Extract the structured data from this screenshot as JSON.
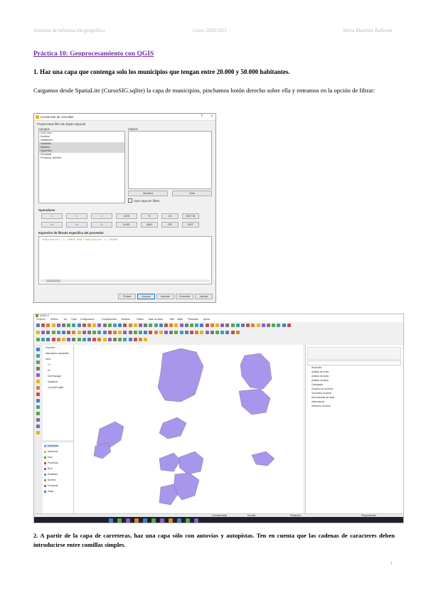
{
  "header": {
    "left": "Sistemas de información geográfica",
    "center": "Curso 2020/2021",
    "right": "Silvia Martínez Ballester"
  },
  "title": "Práctica 10: Geoprocesamiento con QGIS",
  "question1": "1. Haz una capa que contenga solo los municipios que tengan entre 20.000 y 50.000 habitantes.",
  "paragraph1": "Cargamos desde SpatiaLite (CursoSIG.sqlite) la capa de municipios, pinchamos botón derecho sobre ella y entramos en la opción de filtrar:",
  "question2": "2. A partir de la capa de carreteras, haz una capa sólo con autovías y autopistas. Ten en cuenta que las cadenas de caracteres deben introducirse entre comillas simples.",
  "page_number": "1",
  "filter_dialog": {
    "window_title": "Constructor de consultas",
    "section_label": "Proporcionar filtro de objeto espacial",
    "fields_label": "Campos",
    "values_label": "Valores",
    "fields": [
      "Cod_mun",
      "Nombre",
      "Habitantes",
      "Hombres",
      "Mujeres",
      "Superficie",
      "Densidad",
      "Provincia_Nombre"
    ],
    "sample_button": "Muestra",
    "all_button": "Todo",
    "use_unfiltered": "Usar capa sin filtrar",
    "operators_label": "Operadores",
    "operators_row1": [
      "=",
      "<",
      ">",
      "LIKE",
      "%",
      "IN",
      "NOT IN"
    ],
    "operators_row2": [
      "<=",
      ">=",
      "!=",
      "ILIKE",
      "AND",
      "OR",
      "NOT"
    ],
    "expression_label": "Expresión de filtrado específica del proveedor",
    "expression": "\"Habitantes\" >= 20000 AND \"Habitantes\" <= 50000",
    "buttons": [
      "Probar",
      "Limpiar",
      "Aceptar",
      "Cancelar",
      "Ayuda"
    ]
  },
  "qgis": {
    "window_title": "QGIS 3",
    "menu": [
      "Proyecto",
      "Edición",
      "Ver",
      "Capa",
      "Configuración",
      "Complementos",
      "Vectorial",
      "Ráster",
      "Base de datos",
      "Web",
      "Malla",
      "Procesado",
      "Ayuda"
    ],
    "layers": [
      "municipios",
      "carreteras",
      "Vías",
      "Provincias",
      "Ríos",
      "Embalses",
      "Núcleos",
      "Comarcas",
      "Hojas"
    ],
    "browser_items": [
      "Favoritos",
      "Marcadores espaciales",
      "Inicio",
      "C:\\",
      "D:\\",
      "GeoPackage",
      "SpatiaLite",
      "CursoSIG.sqlite"
    ],
    "processing_items": [
      "Recientes",
      "Análisis de redes",
      "Análisis de ráster",
      "Análisis vectorial",
      "Cartografía",
      "Creación de vectores",
      "Geometría vectorial",
      "Herramientas de ráster",
      "Interpolación",
      "Selección vectorial"
    ],
    "coordinate_label": "Coordenada",
    "scale_label": "Escala",
    "rotation_label": "Rotación",
    "render_label": "Representar",
    "map_fill_color": "#a796ec"
  }
}
